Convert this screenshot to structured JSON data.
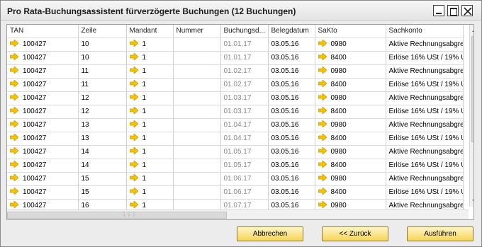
{
  "window": {
    "title": "Pro Rata-Buchungsassistent fürverzögerte Buchungen (12 Buchungen)"
  },
  "colors": {
    "arrow": "#f5c400",
    "button": "#f7d356",
    "gray_text": "#8a8a8a"
  },
  "table": {
    "columns": [
      "TAN",
      "Zeile",
      "Mandant",
      "Nummer",
      "Buchungsd...",
      "Belegdatum",
      "SaKto",
      "Sachkonto"
    ],
    "rows": [
      {
        "tan": "100427",
        "zeile": "10",
        "mandant": "1",
        "nummer": "",
        "buchungsdatum": "01.01.17",
        "belegdatum": "03.05.16",
        "sakto": "0980",
        "sachkonto": "Aktive Rechnungsabgre"
      },
      {
        "tan": "100427",
        "zeile": "10",
        "mandant": "1",
        "nummer": "",
        "buchungsdatum": "01.01.17",
        "belegdatum": "03.05.16",
        "sakto": "8400",
        "sachkonto": "Erlöse 16% USt / 19% U"
      },
      {
        "tan": "100427",
        "zeile": "11",
        "mandant": "1",
        "nummer": "",
        "buchungsdatum": "01.02.17",
        "belegdatum": "03.05.16",
        "sakto": "0980",
        "sachkonto": "Aktive Rechnungsabgre"
      },
      {
        "tan": "100427",
        "zeile": "11",
        "mandant": "1",
        "nummer": "",
        "buchungsdatum": "01.02.17",
        "belegdatum": "03.05.16",
        "sakto": "8400",
        "sachkonto": "Erlöse 16% USt / 19% U"
      },
      {
        "tan": "100427",
        "zeile": "12",
        "mandant": "1",
        "nummer": "",
        "buchungsdatum": "01.03.17",
        "belegdatum": "03.05.16",
        "sakto": "0980",
        "sachkonto": "Aktive Rechnungsabgre"
      },
      {
        "tan": "100427",
        "zeile": "12",
        "mandant": "1",
        "nummer": "",
        "buchungsdatum": "01.03.17",
        "belegdatum": "03.05.16",
        "sakto": "8400",
        "sachkonto": "Erlöse 16% USt / 19% U"
      },
      {
        "tan": "100427",
        "zeile": "13",
        "mandant": "1",
        "nummer": "",
        "buchungsdatum": "01.04.17",
        "belegdatum": "03.05.16",
        "sakto": "0980",
        "sachkonto": "Aktive Rechnungsabgre"
      },
      {
        "tan": "100427",
        "zeile": "13",
        "mandant": "1",
        "nummer": "",
        "buchungsdatum": "01.04.17",
        "belegdatum": "03.05.16",
        "sakto": "8400",
        "sachkonto": "Erlöse 16% USt / 19% U"
      },
      {
        "tan": "100427",
        "zeile": "14",
        "mandant": "1",
        "nummer": "",
        "buchungsdatum": "01.05.17",
        "belegdatum": "03.05.16",
        "sakto": "0980",
        "sachkonto": "Aktive Rechnungsabgre"
      },
      {
        "tan": "100427",
        "zeile": "14",
        "mandant": "1",
        "nummer": "",
        "buchungsdatum": "01.05.17",
        "belegdatum": "03.05.16",
        "sakto": "8400",
        "sachkonto": "Erlöse 16% USt / 19% U"
      },
      {
        "tan": "100427",
        "zeile": "15",
        "mandant": "1",
        "nummer": "",
        "buchungsdatum": "01.06.17",
        "belegdatum": "03.05.16",
        "sakto": "0980",
        "sachkonto": "Aktive Rechnungsabgre"
      },
      {
        "tan": "100427",
        "zeile": "15",
        "mandant": "1",
        "nummer": "",
        "buchungsdatum": "01.06.17",
        "belegdatum": "03.05.16",
        "sakto": "8400",
        "sachkonto": "Erlöse 16% USt / 19% U"
      },
      {
        "tan": "100427",
        "zeile": "16",
        "mandant": "1",
        "nummer": "",
        "buchungsdatum": "01.07.17",
        "belegdatum": "03.05.16",
        "sakto": "0980",
        "sachkonto": "Aktive Rechnungsabgre"
      }
    ]
  },
  "buttons": {
    "cancel": "Abbrechen",
    "back": "<< Zurück",
    "execute": "Ausführen"
  }
}
